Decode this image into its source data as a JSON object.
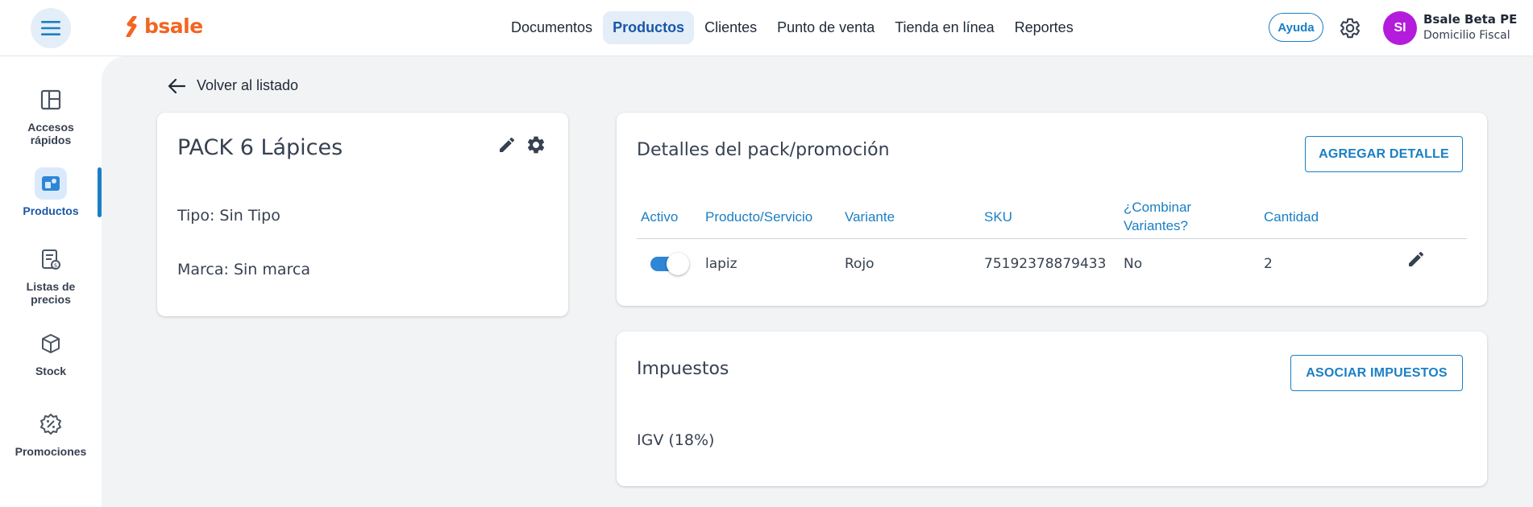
{
  "header": {
    "logo_text": "bsale",
    "nav": [
      {
        "label": "Documentos",
        "active": false
      },
      {
        "label": "Productos",
        "active": true
      },
      {
        "label": "Clientes",
        "active": false
      },
      {
        "label": "Punto de venta",
        "active": false
      },
      {
        "label": "Tienda en línea",
        "active": false
      },
      {
        "label": "Reportes",
        "active": false
      }
    ],
    "help_label": "Ayuda",
    "avatar_initials": "SI",
    "user_name": "Bsale Beta PE",
    "user_subtitle": "Domicilio Fiscal"
  },
  "sidebar": {
    "items": [
      {
        "label": "Accesos rápidos",
        "icon": "layout-icon"
      },
      {
        "label": "Productos",
        "icon": "products-icon",
        "active": true
      },
      {
        "label": "Listas de precios",
        "icon": "price-list-icon"
      },
      {
        "label": "Stock",
        "icon": "box-icon"
      },
      {
        "label": "Promociones",
        "icon": "discount-badge-icon"
      }
    ]
  },
  "back_link": "Volver al listado",
  "product": {
    "title": "PACK 6 Lápices",
    "type": "Tipo: Sin Tipo",
    "brand": "Marca: Sin marca"
  },
  "details": {
    "title": "Detalles del pack/promoción",
    "add_button": "AGREGAR DETALLE",
    "columns": [
      "Activo",
      "Producto/Servicio",
      "Variante",
      "SKU",
      "¿Combinar",
      "Variantes?",
      "Cantidad"
    ],
    "rows": [
      {
        "active": true,
        "product": "lapiz",
        "variant": "Rojo",
        "sku": "75192378879433",
        "combine": "No",
        "quantity": "2"
      }
    ]
  },
  "taxes": {
    "title": "Impuestos",
    "associate_button": "ASOCIAR IMPUESTOS",
    "items": [
      "IGV (18%)"
    ]
  },
  "colors": {
    "brand": "#f26522",
    "primary": "#1a7fc4",
    "active_nav_bg": "#e3eef9",
    "avatar": "#b41cdb",
    "background": "#f2f3f4"
  }
}
